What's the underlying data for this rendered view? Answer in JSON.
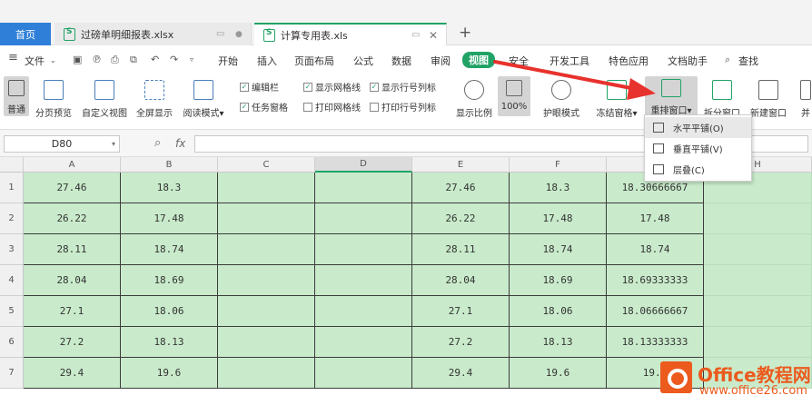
{
  "tabs": {
    "home": "首页",
    "doc1": "过磅单明细报表.xlsx",
    "doc2": "计算专用表.xls",
    "add": "+"
  },
  "menu": {
    "file": "文件",
    "items": [
      "开始",
      "插入",
      "页面布局",
      "公式",
      "数据",
      "审阅",
      "视图",
      "安全",
      "开发工具",
      "特色应用",
      "文档助手"
    ],
    "active_index": 6,
    "search": "查找"
  },
  "ribbon": {
    "buttons": [
      "普通",
      "分页预览",
      "自定义视图",
      "全屏显示",
      "阅读模式"
    ],
    "checks": [
      {
        "label": "编辑栏",
        "checked": true
      },
      {
        "label": "显示网格线",
        "checked": true
      },
      {
        "label": "显示行号列标",
        "checked": true
      },
      {
        "label": "任务窗格",
        "checked": true
      },
      {
        "label": "打印网格线",
        "checked": false
      },
      {
        "label": "打印行号列标",
        "checked": false
      }
    ],
    "zoom_label": "显示比例",
    "zoom_value": "100%",
    "eye_mode": "护眼模式",
    "freeze": "冻结窗格",
    "arrange": "重排窗口",
    "split": "拆分窗口",
    "new_window": "新建窗口",
    "more": "并"
  },
  "dropdown": {
    "items": [
      "水平平铺(O)",
      "垂直平铺(V)",
      "层叠(C)"
    ]
  },
  "formula": {
    "cell_ref": "D80",
    "fx": "fx"
  },
  "grid": {
    "columns": [
      "A",
      "B",
      "C",
      "D",
      "E",
      "F",
      "G",
      "H"
    ],
    "selected_column": "D",
    "rows": [
      {
        "n": "1",
        "a": "27.46",
        "b": "18.3",
        "e": "27.46",
        "f": "18.3",
        "g": "18.30666667"
      },
      {
        "n": "2",
        "a": "26.22",
        "b": "17.48",
        "e": "26.22",
        "f": "17.48",
        "g": "17.48"
      },
      {
        "n": "3",
        "a": "28.11",
        "b": "18.74",
        "e": "28.11",
        "f": "18.74",
        "g": "18.74"
      },
      {
        "n": "4",
        "a": "28.04",
        "b": "18.69",
        "e": "28.04",
        "f": "18.69",
        "g": "18.69333333"
      },
      {
        "n": "5",
        "a": "27.1",
        "b": "18.06",
        "e": "27.1",
        "f": "18.06",
        "g": "18.06666667"
      },
      {
        "n": "6",
        "a": "27.2",
        "b": "18.13",
        "e": "27.2",
        "f": "18.13",
        "g": "18.13333333"
      },
      {
        "n": "7",
        "a": "29.4",
        "b": "19.6",
        "e": "29.4",
        "f": "19.6",
        "g": "19.6"
      }
    ]
  },
  "watermark": {
    "title": "Office教程网",
    "url": "www.office26.com"
  },
  "colors": {
    "accent": "#21a366",
    "cell_fill": "#c9ebcb",
    "arrow": "#e8322d",
    "home_tab": "#2f7fd8",
    "brand": "#ec5a1e"
  }
}
